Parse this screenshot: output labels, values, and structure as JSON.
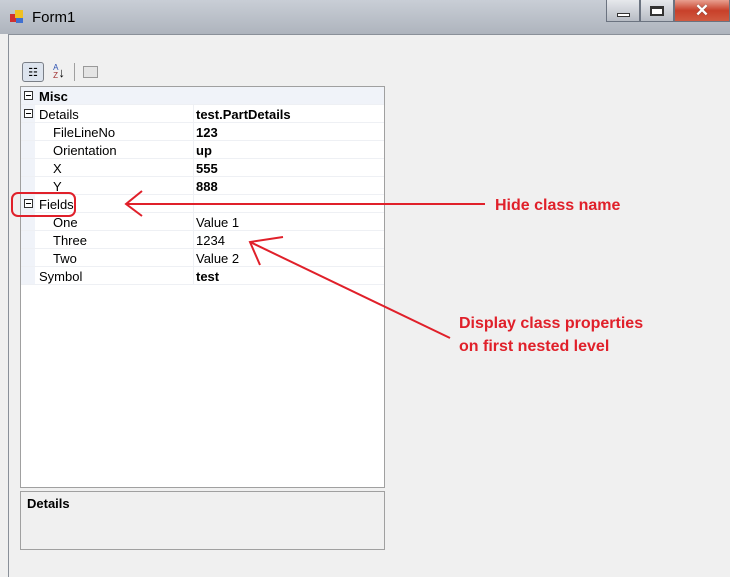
{
  "window": {
    "title": "Form1"
  },
  "toolbar": {
    "categorized": "categorized-view",
    "alphabetical": "alphabetical-sort",
    "pages": "property-pages"
  },
  "grid": {
    "rows": [
      {
        "label": "Misc",
        "value": "",
        "type": "category"
      },
      {
        "label": "Details",
        "value": "test.PartDetails",
        "type": "expandable"
      },
      {
        "label": "FileLineNo",
        "value": "123",
        "type": "child"
      },
      {
        "label": "Orientation",
        "value": "up",
        "type": "child"
      },
      {
        "label": "X",
        "value": "555",
        "type": "child"
      },
      {
        "label": "Y",
        "value": "888",
        "type": "child"
      },
      {
        "label": "Fields",
        "value": "",
        "type": "expandable"
      },
      {
        "label": "One",
        "value": "Value 1",
        "type": "child"
      },
      {
        "label": "Three",
        "value": "1234",
        "type": "child"
      },
      {
        "label": "Two",
        "value": "Value 2",
        "type": "child"
      },
      {
        "label": "Symbol",
        "value": "test",
        "type": "prop"
      }
    ]
  },
  "description": {
    "title": "Details"
  },
  "annotations": {
    "hide": "Hide class name",
    "display_line1": "Display class properties",
    "display_line2": "on first nested level",
    "color": "#e0202a"
  }
}
